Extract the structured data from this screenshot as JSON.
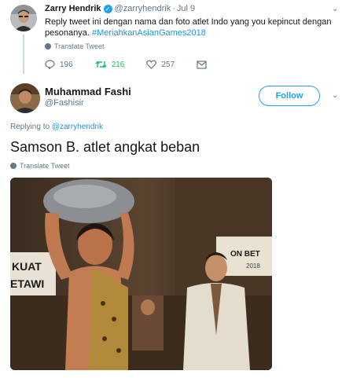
{
  "parent_tweet": {
    "author_name": "Zarry Hendrik",
    "handle": "@zarryhendrik",
    "separator": "·",
    "date": "Jul 9",
    "text_main": "Reply tweet ini dengan nama dan foto atlet Indo yang you kepincut dengan pesonanya.",
    "hashtag": "#MeriahkanAsianGames2018",
    "translate": "Translate Tweet",
    "replies": "196",
    "retweets": "216",
    "likes": "257"
  },
  "reply_tweet": {
    "author_name": "Muhammad Fashi",
    "handle": "@Fashisir",
    "follow_label": "Follow",
    "replying_prefix": "Replying to",
    "replying_to": "@zarryhendrik",
    "text": "Samson B. atlet angkat beban",
    "translate": "Translate Tweet"
  },
  "media_signs": {
    "left_sign_line1": "KUAT",
    "left_sign_line2": "ETAWI",
    "right_sign_line1": "ON BET",
    "right_sign_line2": "2018"
  },
  "colors": {
    "link": "#1b95e0",
    "brand": "#1da1f2",
    "retweet": "#17bf63",
    "muted": "#657786"
  },
  "icons": {
    "reply": "reply-icon",
    "retweet": "retweet-icon",
    "like": "heart-icon",
    "dm": "envelope-icon",
    "verified": "verified-badge-icon",
    "caret": "chevron-down-icon",
    "globe": "globe-icon"
  }
}
